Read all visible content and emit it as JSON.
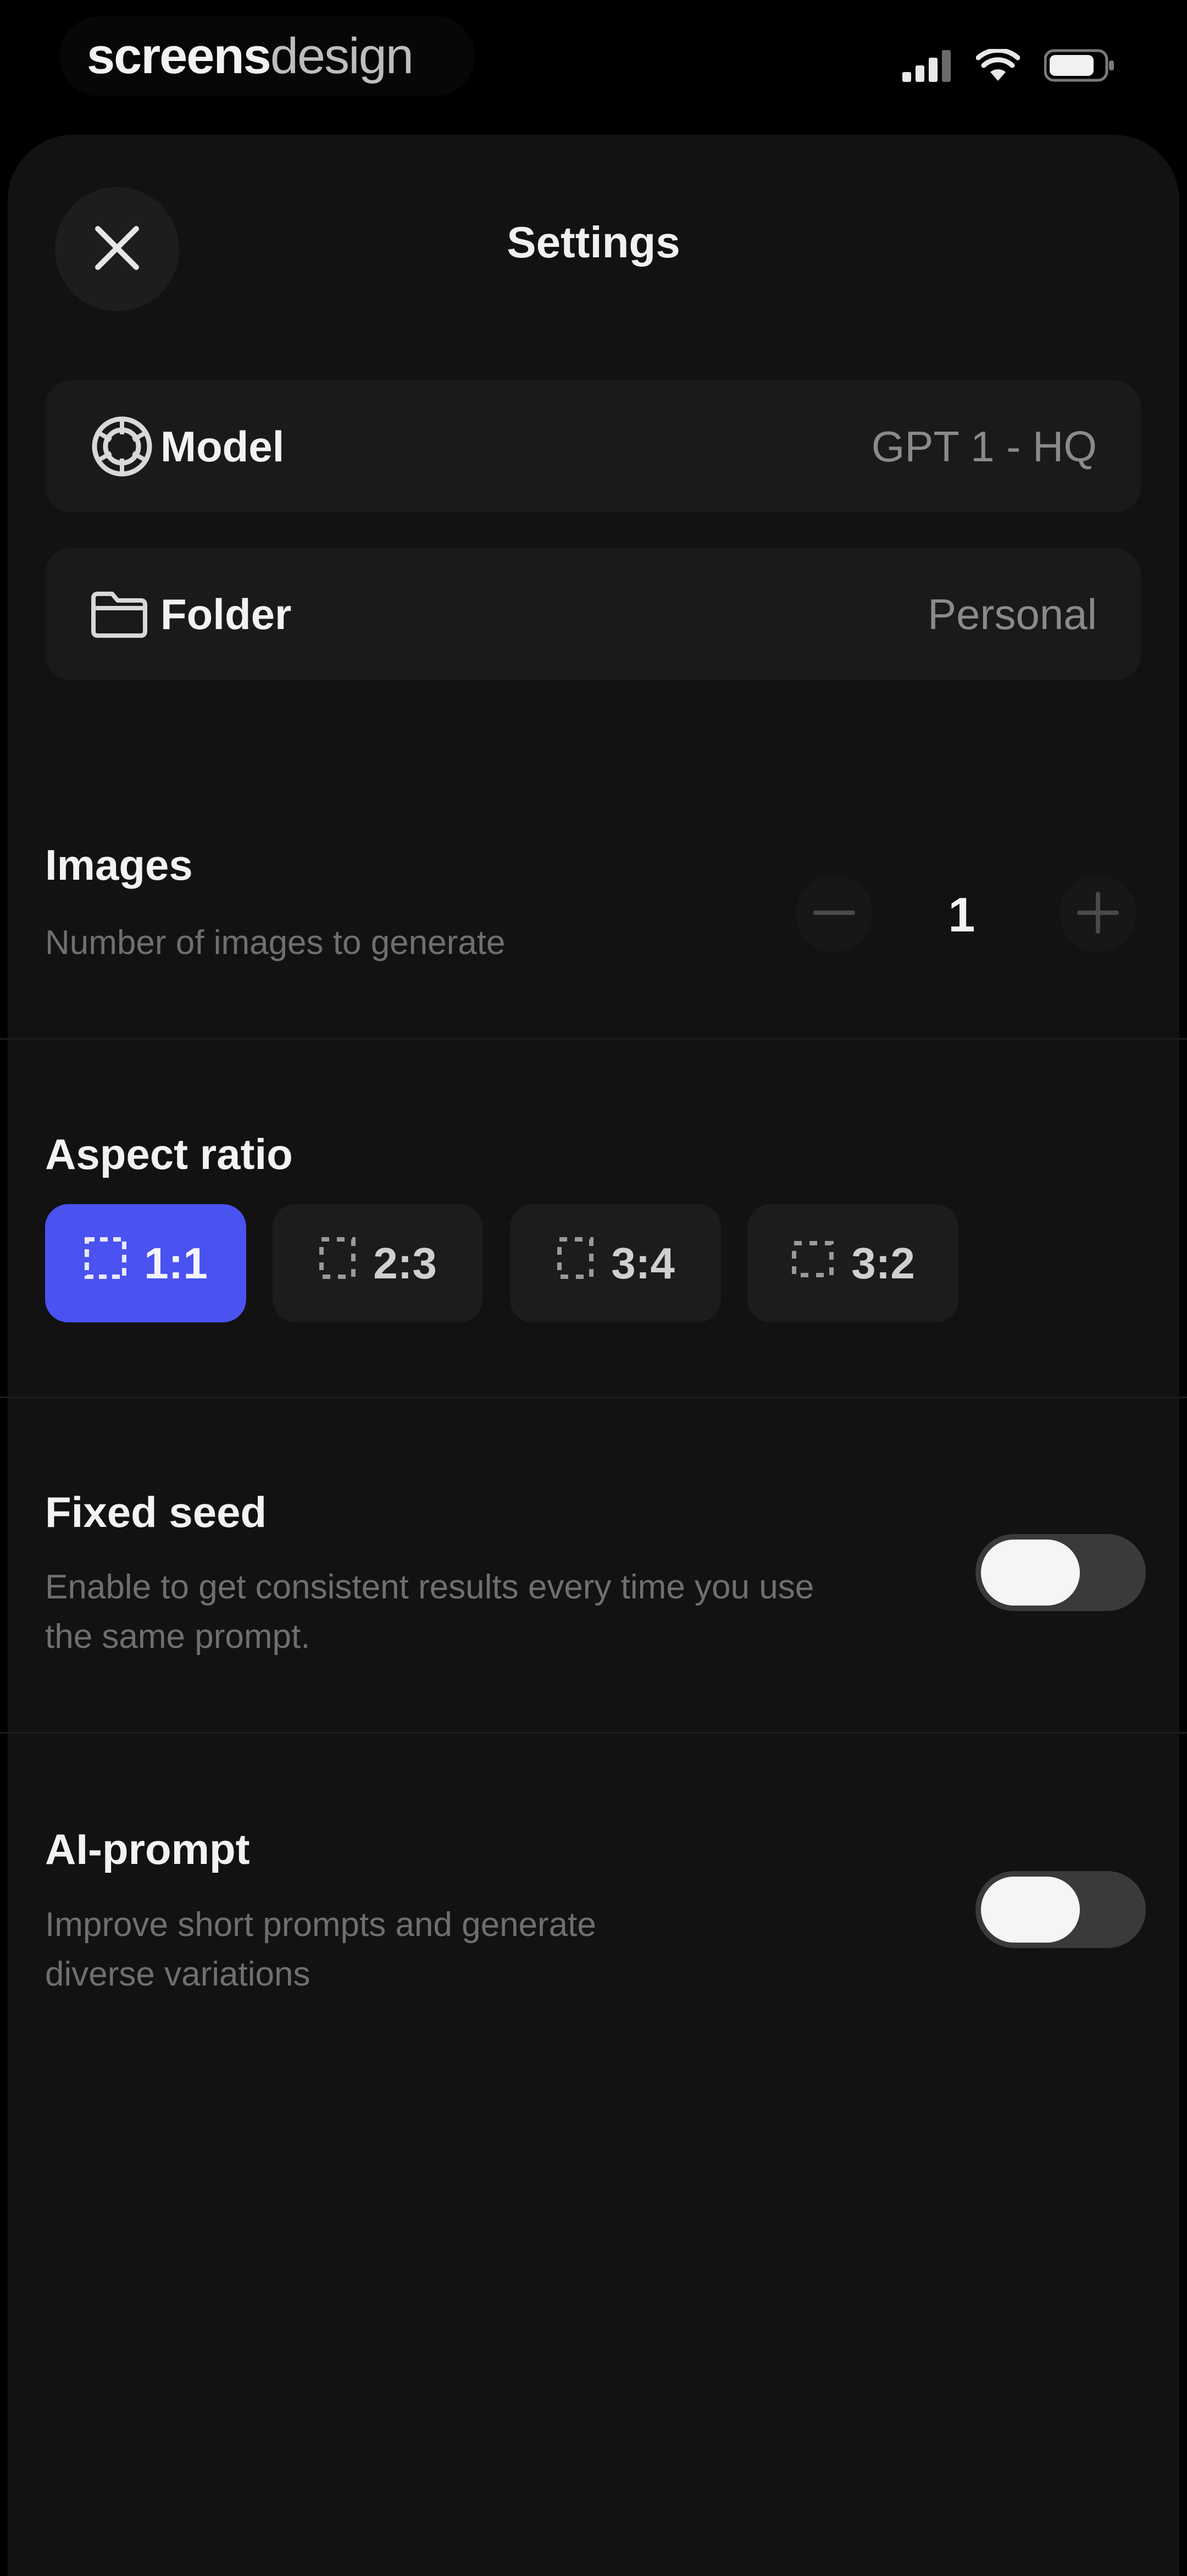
{
  "status_bar": {
    "brand_bold": "screens",
    "brand_light": "design",
    "icons": [
      "cellular-signal-icon",
      "wifi-icon",
      "battery-icon"
    ]
  },
  "header": {
    "title": "Settings",
    "close_icon": "close-icon"
  },
  "model_row": {
    "label": "Model",
    "value": "GPT 1 - HQ",
    "icon": "openai-logo-icon"
  },
  "folder_row": {
    "label": "Folder",
    "value": "Personal",
    "icon": "folder-icon"
  },
  "images": {
    "title": "Images",
    "description": "Number of images to generate",
    "value": "1",
    "decrement_icon": "minus-icon",
    "increment_icon": "plus-icon"
  },
  "aspect_ratio": {
    "title": "Aspect ratio",
    "options": [
      {
        "label": "1:1",
        "selected": true
      },
      {
        "label": "2:3",
        "selected": false
      },
      {
        "label": "3:4",
        "selected": false
      },
      {
        "label": "3:2",
        "selected": false
      }
    ]
  },
  "fixed_seed": {
    "title": "Fixed seed",
    "description_line1": "Enable to get consistent results every time you use",
    "description_line2": "the same prompt.",
    "enabled": false
  },
  "ai_prompt": {
    "title": "AI-prompt",
    "description_line1": "Improve short prompts and generate",
    "description_line2": "diverse variations",
    "enabled": false
  },
  "colors": {
    "accent": "#4a52f0",
    "background": "#121212",
    "card": "#1a1a1a"
  }
}
